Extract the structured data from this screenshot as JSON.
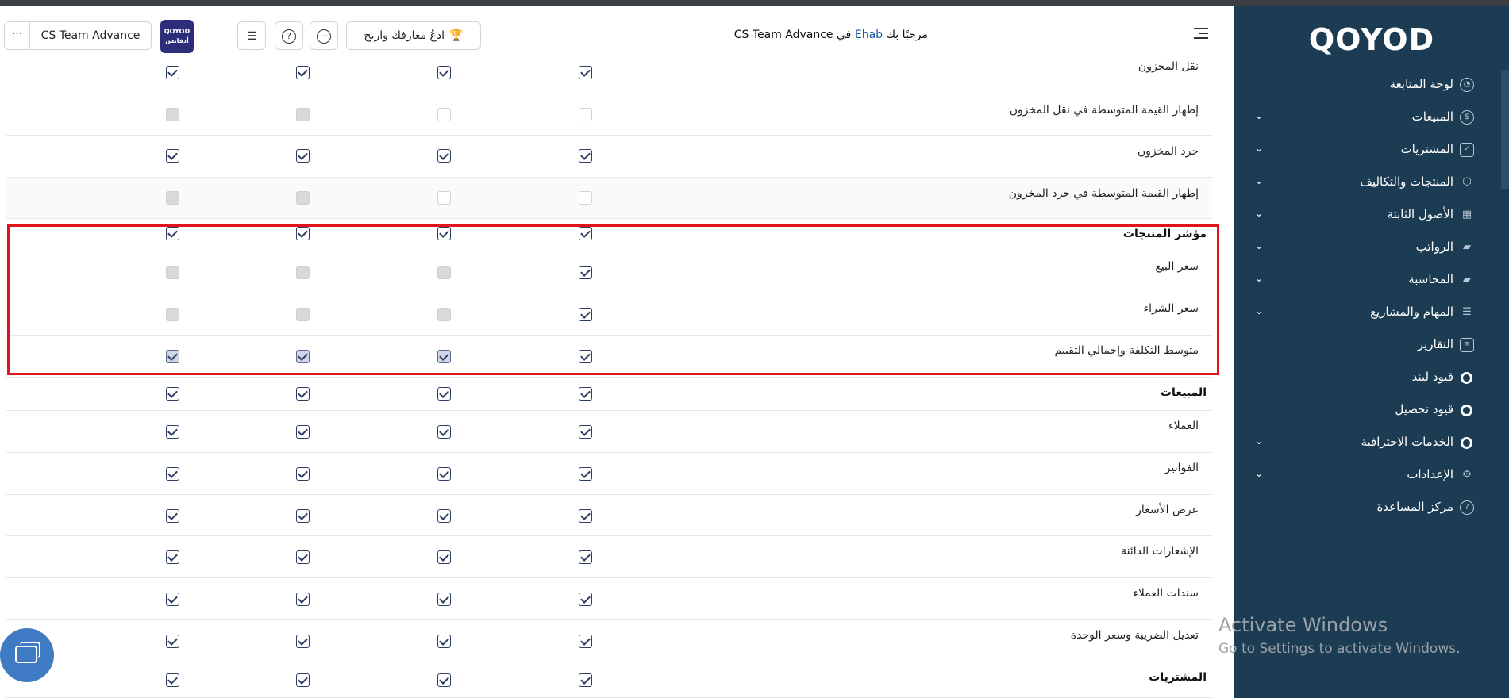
{
  "brand": {
    "logo": "QOYOD"
  },
  "header": {
    "welcome_prefix": "مرحبًا بك",
    "user": "Ehab",
    "welcome_mid": "في",
    "company": "CS Team Advance",
    "learn_button": "ادعُ معارفك واربح",
    "company_button": "CS Team Advance",
    "more": "···",
    "company_logo_top": "QOYOD",
    "company_logo_bottom": "أدفانس"
  },
  "sidebar": {
    "items": [
      {
        "label": "لوحة المتابعة",
        "icon": "gauge-icon"
      },
      {
        "label": "المبيعات",
        "icon": "dollar-icon"
      },
      {
        "label": "المشتريات",
        "icon": "clipboard-icon"
      },
      {
        "label": "المنتجات والتكاليف",
        "icon": "box-icon"
      },
      {
        "label": "الأصول الثابتة",
        "icon": "table-icon"
      },
      {
        "label": "الرواتب",
        "icon": "folder-icon"
      },
      {
        "label": "المحاسبة",
        "icon": "folder-icon"
      },
      {
        "label": "المهام والمشاريع",
        "icon": "tasks-icon"
      },
      {
        "label": "التقارير",
        "icon": "report-icon"
      },
      {
        "label": "قيود ليند",
        "icon": "qoyod-q-icon"
      },
      {
        "label": "قيود تحصيل",
        "icon": "qoyod-q-icon"
      },
      {
        "label": "الخدمات الاحترافية",
        "icon": "qoyod-q-icon"
      },
      {
        "label": "الإعدادات",
        "icon": "gear-icon"
      },
      {
        "label": "مركز المساعدة",
        "icon": "help-icon"
      }
    ]
  },
  "permissions": {
    "rows": [
      {
        "label": "نقل المخزون",
        "bold": false,
        "states": [
          "on",
          "on",
          "on",
          "on"
        ]
      },
      {
        "label": "إظهار القيمة المتوسطة في نقل المخزون",
        "bold": false,
        "states": [
          "off",
          "off",
          "dis",
          "dis"
        ]
      },
      {
        "label": "جرد المخزون",
        "bold": false,
        "states": [
          "on",
          "on",
          "on",
          "on"
        ]
      },
      {
        "label": "إظهار القيمة المتوسطة في جرد المخزون",
        "bold": false,
        "states": [
          "off",
          "off",
          "dis",
          "dis"
        ]
      },
      {
        "label": "مؤشر المنتجات",
        "bold": true,
        "states": [
          "on",
          "on",
          "on",
          "on"
        ]
      },
      {
        "label": "سعر البيع",
        "bold": false,
        "states": [
          "on",
          "dis",
          "dis",
          "dis"
        ]
      },
      {
        "label": "سعر الشراء",
        "bold": false,
        "states": [
          "on",
          "dis",
          "dis",
          "dis"
        ]
      },
      {
        "label": "متوسط التكلفة وإجمالي التقييم",
        "bold": false,
        "states": [
          "on",
          "ondim",
          "ondim",
          "ondim"
        ]
      },
      {
        "label": "المبيعات",
        "bold": true,
        "states": [
          "on",
          "on",
          "on",
          "on"
        ]
      },
      {
        "label": "العملاء",
        "bold": false,
        "states": [
          "on",
          "on",
          "on",
          "on"
        ]
      },
      {
        "label": "الفواتير",
        "bold": false,
        "states": [
          "on",
          "on",
          "on",
          "on"
        ]
      },
      {
        "label": "عرض الأسعار",
        "bold": false,
        "states": [
          "on",
          "on",
          "on",
          "on"
        ]
      },
      {
        "label": "الإشعارات الدائنة",
        "bold": false,
        "states": [
          "on",
          "on",
          "on",
          "on"
        ]
      },
      {
        "label": "سندات العملاء",
        "bold": false,
        "states": [
          "on",
          "on",
          "on",
          "on"
        ]
      },
      {
        "label": "تعديل الضريبة وسعر الوحدة",
        "bold": false,
        "states": [
          "on",
          "on",
          "on",
          "on"
        ]
      },
      {
        "label": "المشتريات",
        "bold": true,
        "states": [
          "on",
          "on",
          "on",
          "on"
        ]
      }
    ]
  },
  "watermark": {
    "line1": "Activate Windows",
    "line2": "Go to Settings to activate Windows."
  },
  "colors": {
    "sidebar": "#1b3c52",
    "highlight": "#e0141d",
    "accent": "#1a56a4",
    "fab": "#3f7bc4"
  }
}
